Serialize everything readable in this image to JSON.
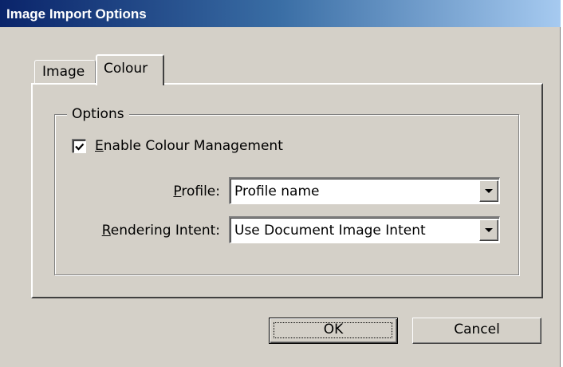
{
  "window": {
    "title": "Image Import Options"
  },
  "tabs": [
    {
      "label": "Image",
      "active": false
    },
    {
      "label": "Colour",
      "active": true
    }
  ],
  "options_group": {
    "legend": "Options",
    "enable_colour_management": {
      "label_mnemonic": "E",
      "label_rest": "nable Colour Management",
      "checked": true
    },
    "profile": {
      "label_mnemonic": "P",
      "label_rest": "rofile:",
      "value": "Profile name"
    },
    "rendering_intent": {
      "label_mnemonic": "R",
      "label_rest": "endering Intent:",
      "value": "Use Document Image Intent"
    }
  },
  "buttons": {
    "ok": "OK",
    "cancel": "Cancel"
  },
  "icons": {
    "dropdown": "chevron-down-icon",
    "check": "checkmark-icon"
  },
  "colors": {
    "titlebar_start": "#0a246a",
    "titlebar_end": "#a6caf0",
    "dialog_face": "#d4d0c8"
  }
}
